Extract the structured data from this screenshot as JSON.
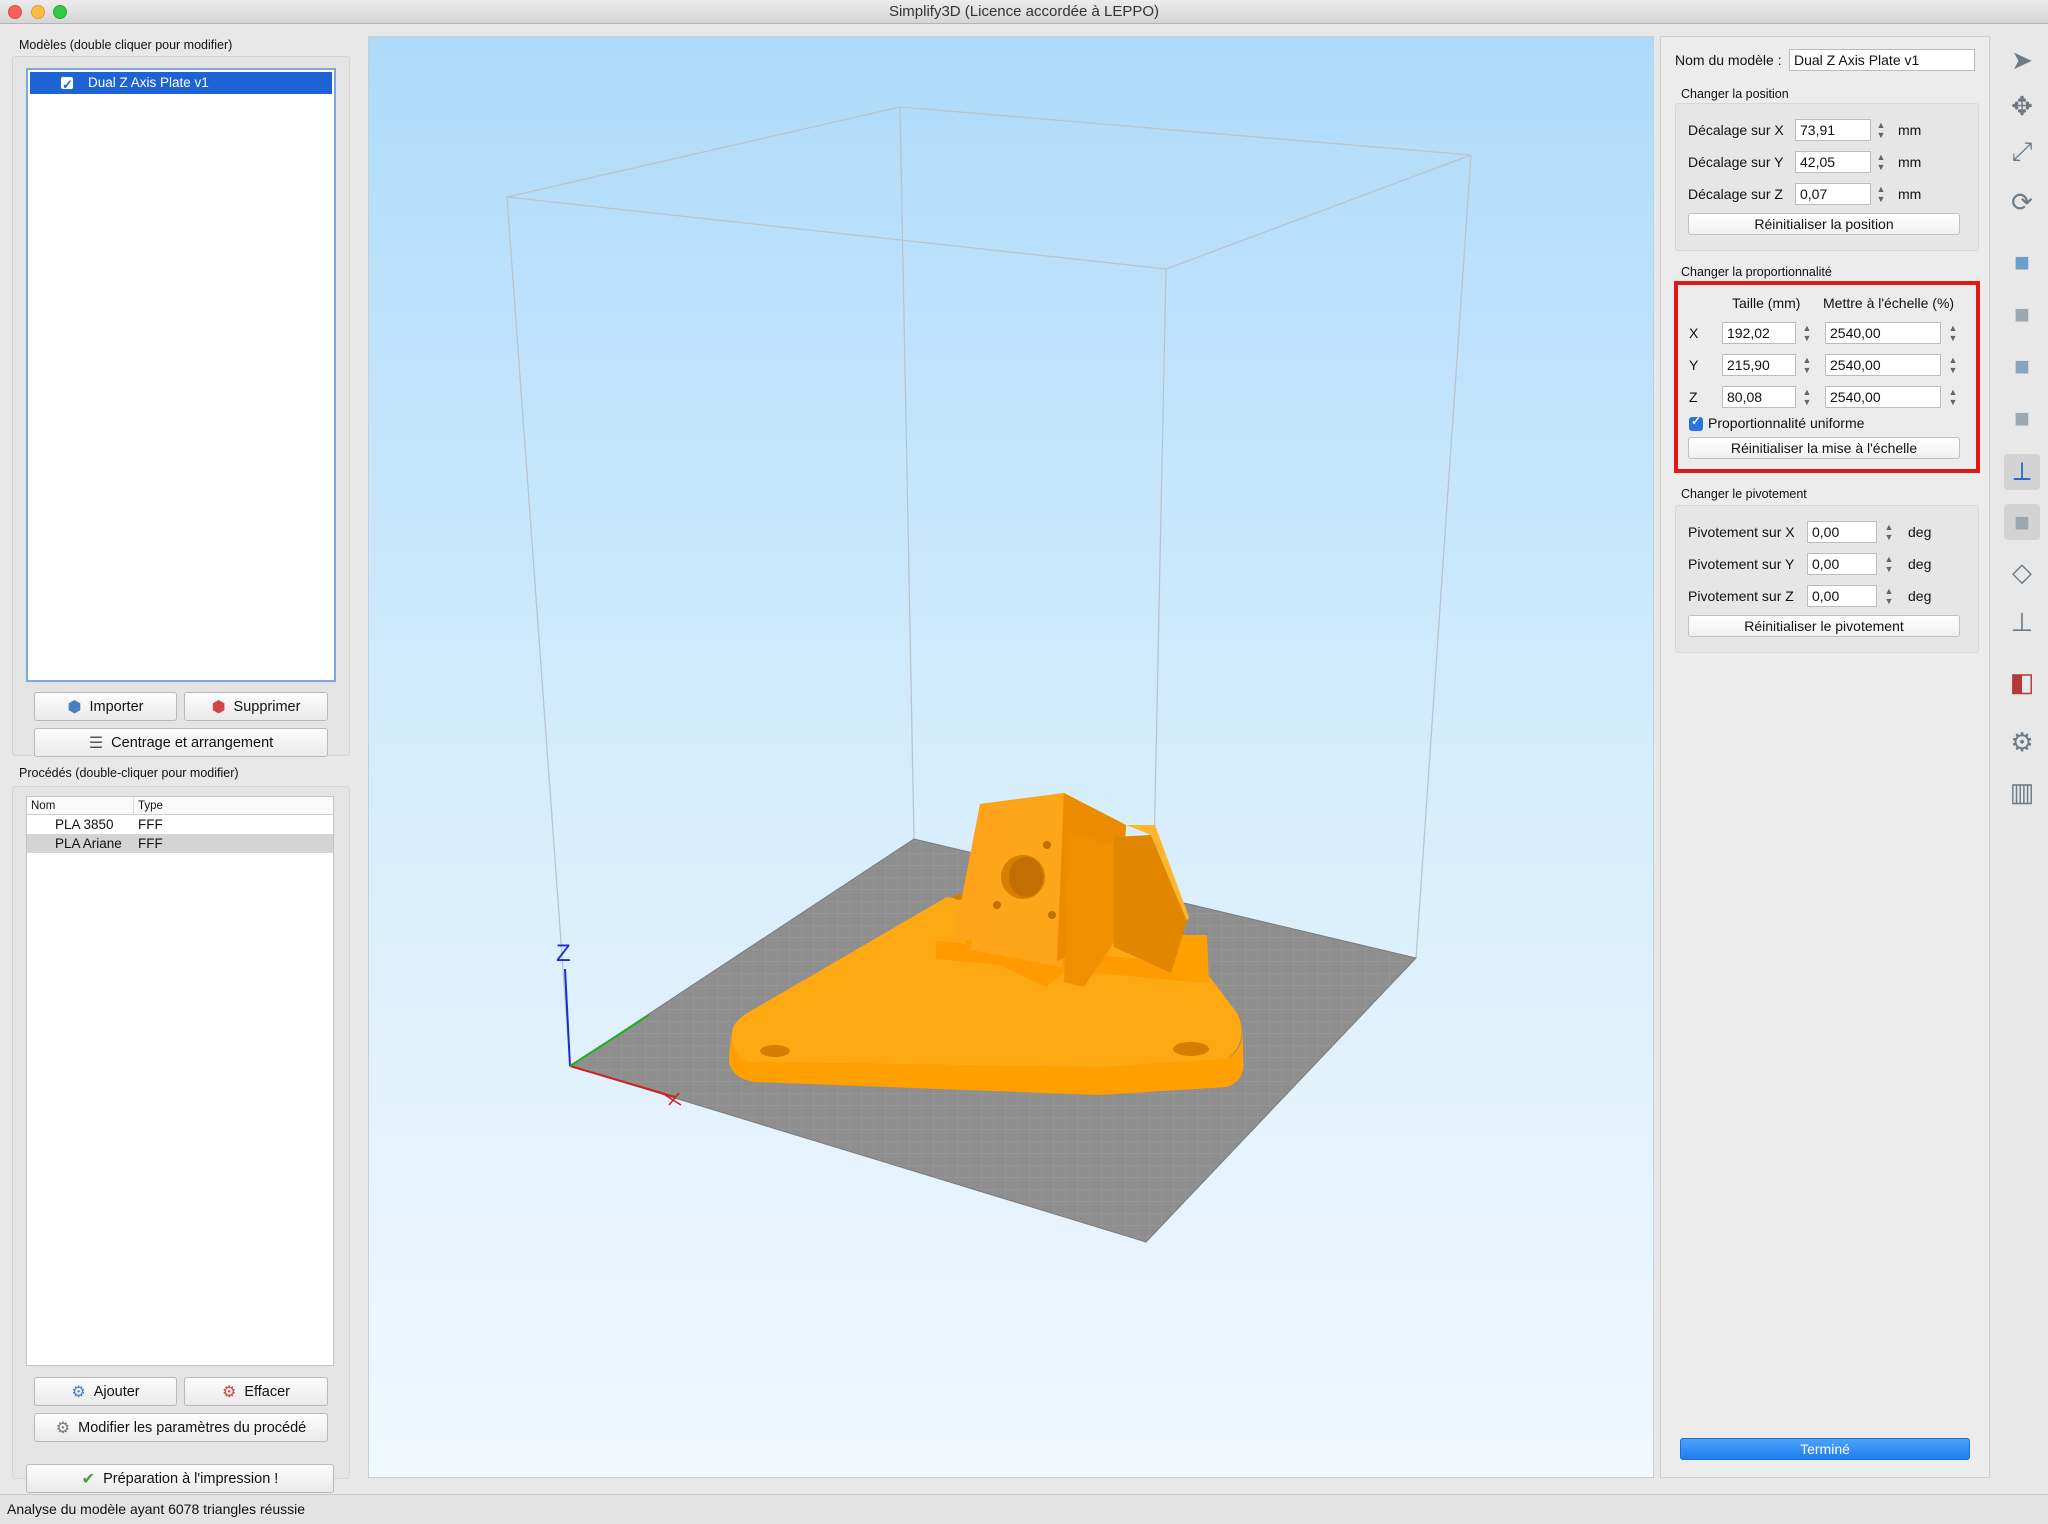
{
  "window": {
    "title": "Simplify3D (Licence accordée à LEPPO)"
  },
  "models": {
    "label": "Modèles (double cliquer pour modifier)",
    "items": [
      {
        "name": "Dual Z Axis Plate v1",
        "checked": true
      }
    ],
    "import_label": "Importer",
    "delete_label": "Supprimer",
    "arrange_label": "Centrage et arrangement"
  },
  "processes": {
    "label": "Procédés (double-cliquer pour modifier)",
    "columns": [
      "Nom",
      "Type"
    ],
    "rows": [
      {
        "name": "PLA 3850",
        "type": "FFF"
      },
      {
        "name": "PLA Ariane",
        "type": "FFF"
      }
    ],
    "add_label": "Ajouter",
    "clear_label": "Effacer",
    "modify_label": "Modifier les paramètres du procédé",
    "prepare_label": "Préparation à l'impression !"
  },
  "viewport": {
    "axis_z_label": "Z",
    "model_color": "#ffa300",
    "bed_color": "#8c8c8c"
  },
  "properties": {
    "model_name_label": "Nom du modèle :",
    "model_name_value": "Dual Z Axis Plate v1",
    "position": {
      "title": "Changer la position",
      "x_label": "Décalage sur X",
      "x_value": "73,91",
      "y_label": "Décalage sur Y",
      "y_value": "42,05",
      "z_label": "Décalage sur Z",
      "z_value": "0,07",
      "unit": "mm",
      "reset_label": "Réinitialiser la position"
    },
    "scale": {
      "title": "Changer la proportionnalité",
      "size_header": "Taille (mm)",
      "scale_header": "Mettre à l'échelle (%)",
      "x_label": "X",
      "x_size": "192,02",
      "x_scale": "2540,00",
      "y_label": "Y",
      "y_size": "215,90",
      "y_scale": "2540,00",
      "z_label": "Z",
      "z_size": "80,08",
      "z_scale": "2540,00",
      "uniform_label": "Proportionnalité uniforme",
      "uniform_checked": true,
      "reset_label": "Réinitialiser la mise à l'échelle",
      "highlight_color": "#e01818"
    },
    "rotation": {
      "title": "Changer le pivotement",
      "x_label": "Pivotement sur X",
      "x_value": "0,00",
      "y_label": "Pivotement sur Y",
      "y_value": "0,00",
      "z_label": "Pivotement sur Z",
      "z_value": "0,00",
      "unit": "deg",
      "reset_label": "Réinitialiser le pivotement"
    },
    "done_label": "Terminé"
  },
  "toolbar": {
    "tools": [
      "select-arrow-icon",
      "move-icon",
      "scale-icon",
      "rotate-icon",
      "view-default-icon",
      "view-front-icon",
      "view-top-icon",
      "view-side-icon",
      "axes-icon",
      "solid-view-icon",
      "wireframe-icon",
      "floor-icon",
      "cross-section-icon",
      "settings-icon",
      "tools-icon"
    ]
  },
  "status": {
    "text": "Analyse du modèle ayant 6078 triangles réussie"
  }
}
